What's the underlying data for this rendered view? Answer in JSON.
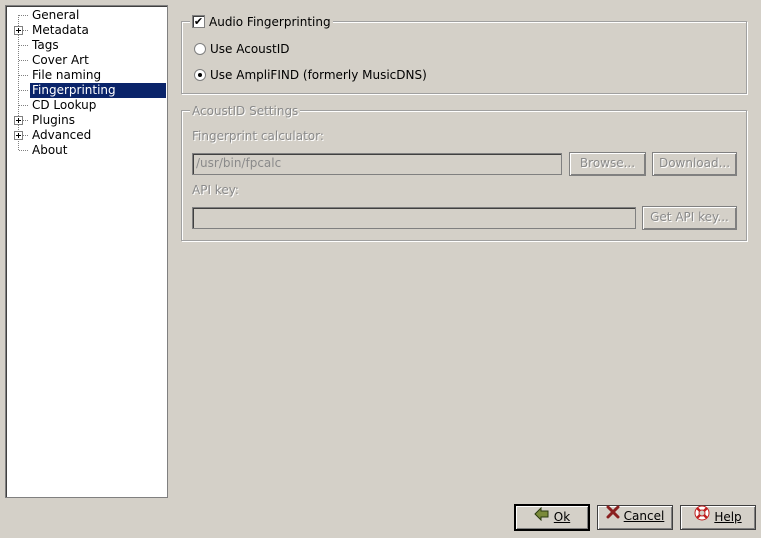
{
  "tree": {
    "items": [
      {
        "label": "General",
        "expandable": false,
        "selected": false
      },
      {
        "label": "Metadata",
        "expandable": true,
        "selected": false
      },
      {
        "label": "Tags",
        "expandable": false,
        "selected": false
      },
      {
        "label": "Cover Art",
        "expandable": false,
        "selected": false
      },
      {
        "label": "File naming",
        "expandable": false,
        "selected": false
      },
      {
        "label": "Fingerprinting",
        "expandable": false,
        "selected": true
      },
      {
        "label": "CD Lookup",
        "expandable": false,
        "selected": false
      },
      {
        "label": "Plugins",
        "expandable": true,
        "selected": false
      },
      {
        "label": "Advanced",
        "expandable": true,
        "selected": false
      },
      {
        "label": "About",
        "expandable": false,
        "selected": false
      }
    ]
  },
  "fingerprinting": {
    "group_title": "Audio Fingerprinting",
    "enabled": true,
    "check_glyph": "✔",
    "options": [
      {
        "label": "Use AcoustID",
        "checked": false
      },
      {
        "label": "Use AmpliFIND (formerly MusicDNS)",
        "checked": true
      }
    ]
  },
  "acoustid": {
    "group_title": "AcoustID Settings",
    "calculator_label": "Fingerprint calculator:",
    "calculator_value": "/usr/bin/fpcalc",
    "browse_label": "Browse...",
    "download_label": "Download...",
    "api_key_label": "API key:",
    "api_key_value": "",
    "get_api_key_label": "Get API key..."
  },
  "dialog": {
    "ok_label": "Ok",
    "cancel_label": "Cancel",
    "help_label": "Help",
    "ok_icon": "ok-arrow-icon",
    "cancel_icon": "cancel-x-icon",
    "help_icon": "help-lifebuoy-icon"
  }
}
